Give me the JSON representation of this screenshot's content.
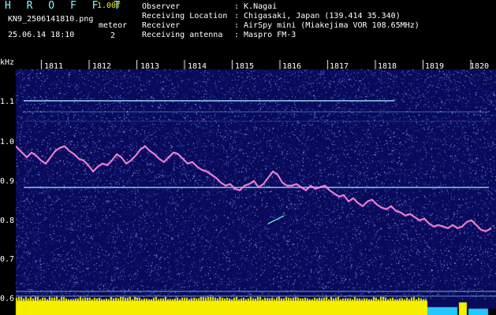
{
  "header": {
    "app_title": "H R O F F T",
    "version": "1.00f",
    "filename": "KN9_2506141810.png",
    "datetime": "25.06.14 18:10",
    "meteor_label": "meteor",
    "meteor_count": "2",
    "info": [
      {
        "key": "Observer",
        "value": ": K.Nagai"
      },
      {
        "key": "Receiving Location",
        "value": ": Chigasaki, Japan (139.414 35.340)"
      },
      {
        "key": "Receiver",
        "value": ": AirSpy mini (Miakejima VOR 108.65MHz)"
      },
      {
        "key": "Receiving antenna",
        "value": ": Maspro FM-3"
      }
    ]
  },
  "axis": {
    "unit": "kHz",
    "x_ticks": [
      "1811",
      "1812",
      "1813",
      "1814",
      "1815",
      "1816",
      "1817",
      "1818",
      "1819",
      "1820"
    ],
    "y_ticks": [
      "1.1",
      "1.0",
      "0.9",
      "0.8",
      "0.7",
      "0.6"
    ]
  },
  "colors": {
    "background": "#0a0a5a",
    "header_cyan": "#8ff5ff",
    "version_yellow": "#f5f000",
    "signal": "#ff60ff",
    "bottom_bar": "#f5f000",
    "carrier_line": "#9fe8ff"
  }
}
